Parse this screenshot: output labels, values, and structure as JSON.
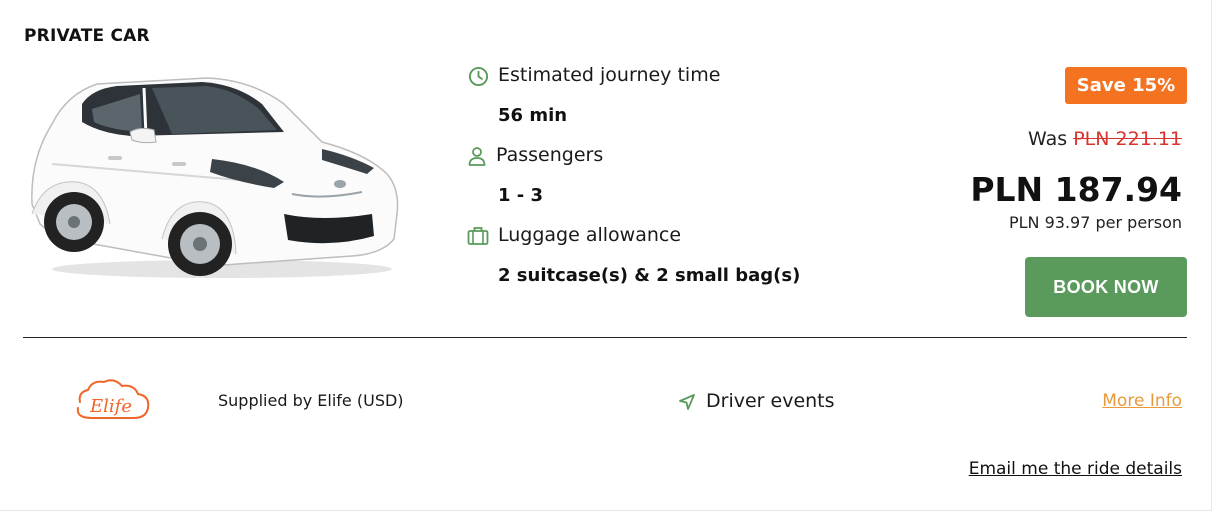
{
  "card": {
    "title": "PRIVATE CAR",
    "vehicle_image": "white-hatchback-car",
    "features": {
      "journey": {
        "icon": "clock-icon",
        "label": "Estimated journey time",
        "value": "56 min"
      },
      "passengers": {
        "icon": "person-icon",
        "label": "Passengers",
        "value": "1 - 3"
      },
      "luggage": {
        "icon": "suitcase-icon",
        "label": "Luggage allowance",
        "value": "2 suitcase(s) & 2 small bag(s)"
      }
    },
    "pricing": {
      "save_badge": "Save 15%",
      "was_label": "Was",
      "was_price": "PLN 221.11",
      "price": "PLN 187.94",
      "per_person": "PLN 93.97 per person",
      "book_label": "BOOK NOW"
    },
    "footer": {
      "supplier_logo_text": "Elife",
      "supplier_text": "Supplied by Elife (USD)",
      "driver_icon": "navigation-arrow-icon",
      "driver_text": "Driver events",
      "more_info": "More Info",
      "email_link": "Email me the ride details"
    }
  },
  "colors": {
    "accent_green": "#5a9a5c",
    "save_orange": "#f47321",
    "strike_red": "#d9332f",
    "link_orange": "#e79a3b"
  }
}
